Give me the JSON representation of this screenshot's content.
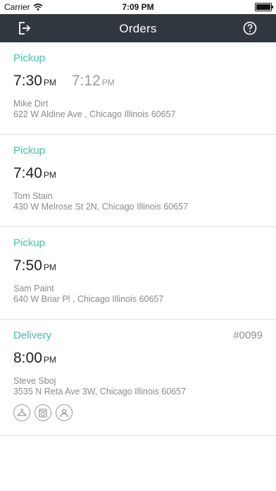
{
  "status_bar": {
    "carrier": "Carrier",
    "time": "7:09 PM"
  },
  "nav": {
    "title": "Orders"
  },
  "orders": [
    {
      "type": "Pickup",
      "time": "7:30",
      "ampm": "PM",
      "alt_time": "7:12",
      "alt_ampm": "PM",
      "name": "Mike Dirt",
      "address": "622 W Aldine Ave , Chicago Illinois 60657"
    },
    {
      "type": "Pickup",
      "time": "7:40",
      "ampm": "PM",
      "name": "Tom Stain",
      "address": "430 W Melrose St 2N, Chicago Illinois 60657"
    },
    {
      "type": "Pickup",
      "time": "7:50",
      "ampm": "PM",
      "name": "Sam Paint",
      "address": "640 W Briar Pl , Chicago Illinois 60657"
    },
    {
      "type": "Delivery",
      "number": "#0099",
      "time": "8:00",
      "ampm": "PM",
      "name": "Steve Sboj",
      "address": "3535 N Reta Ave 3W, Chicago Illinois 60657",
      "service_icons": [
        "hanger-icon",
        "washer-icon",
        "person-icon"
      ]
    }
  ],
  "colors": {
    "nav_bg": "#31373f",
    "accent": "#3cc9b0"
  }
}
